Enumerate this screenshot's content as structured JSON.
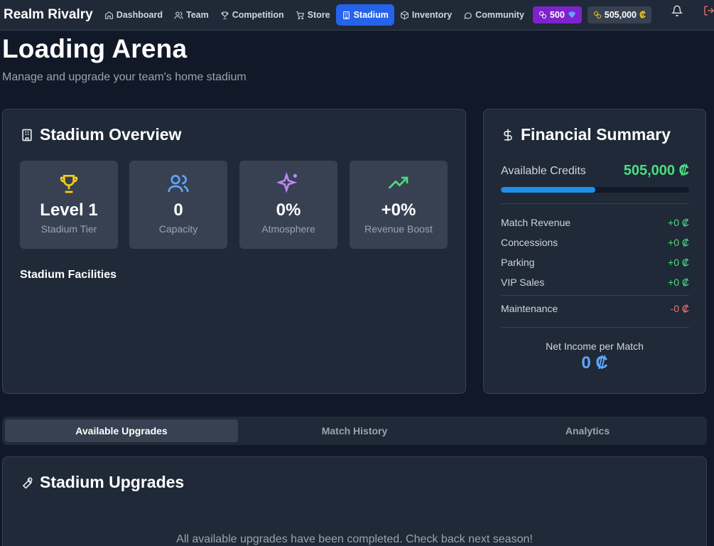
{
  "nav": {
    "brand": "Realm Rivalry",
    "items": [
      {
        "label": "Dashboard",
        "icon": "home-icon"
      },
      {
        "label": "Team",
        "icon": "users-icon"
      },
      {
        "label": "Competition",
        "icon": "trophy-icon"
      },
      {
        "label": "Store",
        "icon": "cart-icon"
      },
      {
        "label": "Stadium",
        "icon": "building-icon",
        "active": true
      },
      {
        "label": "Inventory",
        "icon": "box-icon"
      },
      {
        "label": "Community",
        "icon": "chat-icon"
      }
    ],
    "gems": "500",
    "credits": "505,000",
    "currency_symbol": "₡"
  },
  "header": {
    "title": "Loading Arena",
    "subtitle": "Manage and upgrade your team's home stadium"
  },
  "overview": {
    "title": "Stadium Overview",
    "stats": [
      {
        "value": "Level 1",
        "label": "Stadium Tier",
        "icon": "trophy-icon",
        "color": "#facc15"
      },
      {
        "value": "0",
        "label": "Capacity",
        "icon": "users-icon",
        "color": "#60a5fa"
      },
      {
        "value": "0%",
        "label": "Atmosphere",
        "icon": "sparkles-icon",
        "color": "#c084fc"
      },
      {
        "value": "+0%",
        "label": "Revenue Boost",
        "icon": "trending-up-icon",
        "color": "#4ade80"
      }
    ],
    "facilities_title": "Stadium Facilities"
  },
  "financial": {
    "title": "Financial Summary",
    "available_label": "Available Credits",
    "available_value": "505,000 ₡",
    "progress_fraction": 0.5,
    "rows": [
      {
        "label": "Match Revenue",
        "value": "+0 ₡"
      },
      {
        "label": "Concessions",
        "value": "+0 ₡"
      },
      {
        "label": "Parking",
        "value": "+0 ₡"
      },
      {
        "label": "VIP Sales",
        "value": "+0 ₡"
      }
    ],
    "maintenance": {
      "label": "Maintenance",
      "value": "-0 ₡"
    },
    "net_label": "Net Income per Match",
    "net_value": "0 ₡"
  },
  "tabs": [
    "Available Upgrades",
    "Match History",
    "Analytics"
  ],
  "upgrades": {
    "title": "Stadium Upgrades",
    "message": "All available upgrades have been completed. Check back next season!"
  },
  "colors": {
    "accent": "#2563eb",
    "positive": "#4ade80",
    "negative": "#f87171",
    "gem_badge": "#7e22ce"
  }
}
